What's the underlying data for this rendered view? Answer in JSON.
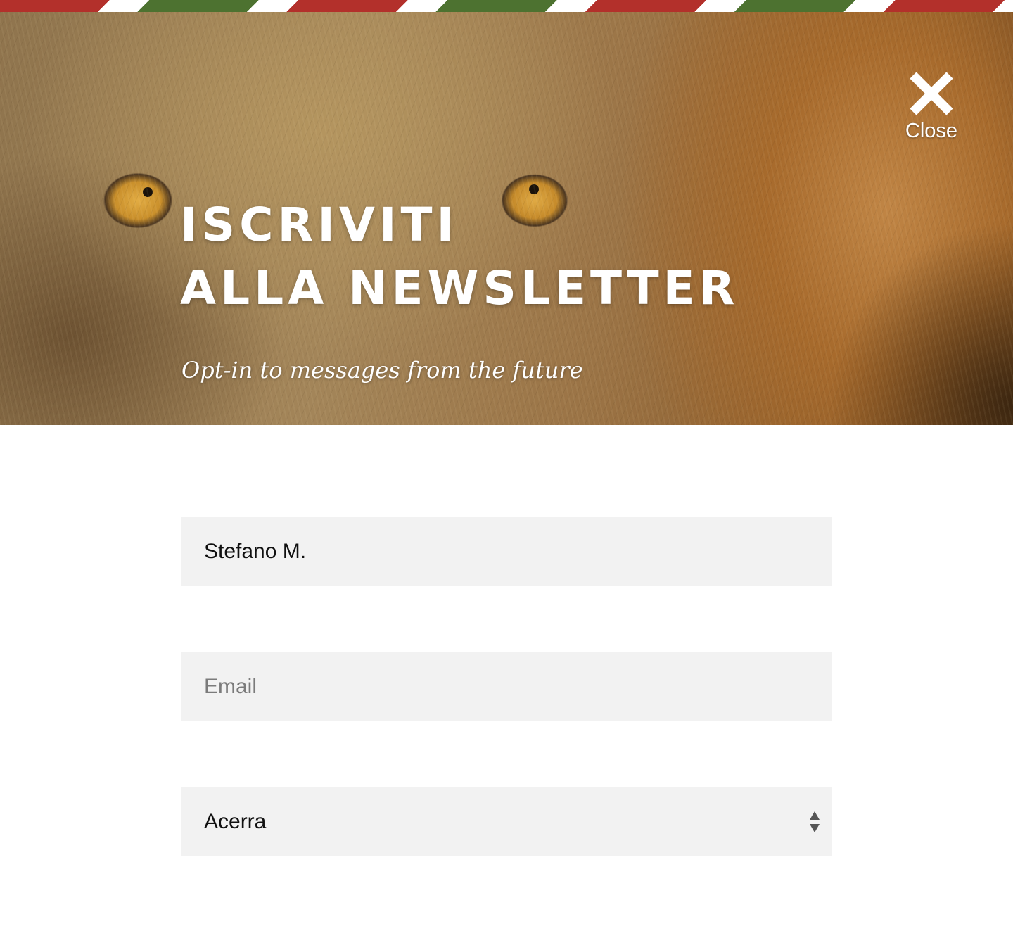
{
  "header": {
    "title_line1": "ISCRIVITI",
    "title_line2": "ALLA NEWSLETTER",
    "subtitle": "Opt-in to messages from the future"
  },
  "close": {
    "label": "Close",
    "icon": "close-icon"
  },
  "form": {
    "name_value": "Stefano M.",
    "email_placeholder": "Email",
    "email_value": "",
    "city_selected": "Acerra"
  },
  "colors": {
    "stripe_red": "#b3302b",
    "stripe_green": "#4d7230",
    "field_bg": "#f2f2f2"
  }
}
